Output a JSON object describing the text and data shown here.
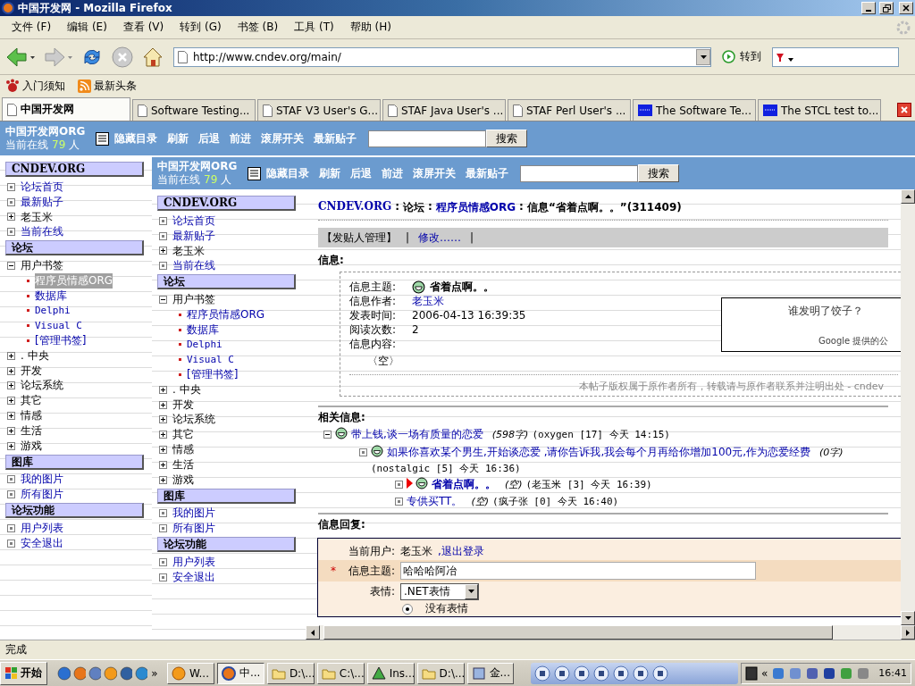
{
  "window": {
    "title": "中国开发网 - Mozilla Firefox"
  },
  "menu": [
    "文件 (F)",
    "编辑 (E)",
    "查看 (V)",
    "转到 (G)",
    "书签 (B)",
    "工具 (T)",
    "帮助 (H)"
  ],
  "navigation": {
    "url": "http://www.cndev.org/main/",
    "go_label": "转到"
  },
  "bookmarks": [
    {
      "label": "入门须知",
      "kind": "paw"
    },
    {
      "label": "最新头条",
      "kind": "feed"
    }
  ],
  "tabs": [
    {
      "label": "中国开发网",
      "selected": true,
      "kind": "page"
    },
    {
      "label": "Software Testing...",
      "selected": false,
      "kind": "page"
    },
    {
      "label": "STAF V3 User's G...",
      "selected": false,
      "kind": "page"
    },
    {
      "label": "STAF Java User's ...",
      "selected": false,
      "kind": "page"
    },
    {
      "label": "STAF Perl User's ...",
      "selected": false,
      "kind": "page"
    },
    {
      "label": "The Software Te...",
      "selected": false,
      "kind": "blue"
    },
    {
      "label": "The STCL test to...",
      "selected": false,
      "kind": "blue"
    }
  ],
  "outer_frame": {
    "header": {
      "site": "中国开发网ORG",
      "online_label": "当前在线",
      "online_count": "79",
      "online_unit": "人",
      "links": [
        "隐藏目录",
        "刷新",
        "后退",
        "前进",
        "滚屏开关",
        "最新贴子"
      ],
      "search_button": "搜索"
    },
    "sidebar": {
      "sections": [
        {
          "title": "CNDEV.ORG",
          "items": [
            {
              "label": "论坛首页",
              "kind": "link"
            },
            {
              "label": "最新贴子",
              "kind": "link"
            },
            {
              "label": "老玉米",
              "kind": "folder",
              "expanded": false
            },
            {
              "label": "当前在线",
              "kind": "link"
            }
          ]
        },
        {
          "title": "论坛",
          "items": [
            {
              "label": "用户书签",
              "kind": "folder",
              "expanded": true,
              "children": [
                {
                  "label": "程序员情感ORG",
                  "selected": true
                },
                {
                  "label": "数据库",
                  "selected": false
                },
                {
                  "label": "Delphi",
                  "selected": false
                },
                {
                  "label": "Visual C",
                  "selected": false
                },
                {
                  "label": "[管理书签]",
                  "selected": false
                }
              ]
            },
            {
              "label": ". 中央",
              "kind": "folder",
              "expanded": false
            },
            {
              "label": "开发",
              "kind": "folder",
              "expanded": false
            },
            {
              "label": "论坛系统",
              "kind": "folder",
              "expanded": false
            },
            {
              "label": "其它",
              "kind": "folder",
              "expanded": false
            },
            {
              "label": "情感",
              "kind": "folder",
              "expanded": false
            },
            {
              "label": "生活",
              "kind": "folder",
              "expanded": false
            },
            {
              "label": "游戏",
              "kind": "folder",
              "expanded": false
            }
          ]
        },
        {
          "title": "图库",
          "items": [
            {
              "label": "我的图片",
              "kind": "link"
            },
            {
              "label": "所有图片",
              "kind": "link"
            }
          ]
        },
        {
          "title": "论坛功能",
          "items": [
            {
              "label": "用户列表",
              "kind": "link"
            },
            {
              "label": "安全退出",
              "kind": "link"
            }
          ]
        }
      ]
    }
  },
  "inner_frame": {
    "header": {
      "site": "中国开发网ORG",
      "online_label": "当前在线",
      "online_count": "79",
      "online_unit": "人",
      "links": [
        "隐藏目录",
        "刷新",
        "后退",
        "前进",
        "滚屏开关",
        "最新贴子"
      ],
      "search_button": "搜索"
    },
    "sidebar": {
      "sections": [
        {
          "title": "CNDEV.ORG",
          "items": [
            {
              "label": "论坛首页",
              "kind": "link"
            },
            {
              "label": "最新贴子",
              "kind": "link"
            },
            {
              "label": "老玉米",
              "kind": "folder",
              "expanded": false
            },
            {
              "label": "当前在线",
              "kind": "link"
            }
          ]
        },
        {
          "title": "论坛",
          "items": [
            {
              "label": "用户书签",
              "kind": "folder",
              "expanded": true,
              "children": [
                {
                  "label": "程序员情感ORG",
                  "selected": false
                },
                {
                  "label": "数据库",
                  "selected": false
                },
                {
                  "label": "Delphi",
                  "selected": false
                },
                {
                  "label": "Visual C",
                  "selected": false
                },
                {
                  "label": "[管理书签]",
                  "selected": false
                }
              ]
            },
            {
              "label": ". 中央",
              "kind": "folder",
              "expanded": false
            },
            {
              "label": "开发",
              "kind": "folder",
              "expanded": false
            },
            {
              "label": "论坛系统",
              "kind": "folder",
              "expanded": false
            },
            {
              "label": "其它",
              "kind": "folder",
              "expanded": false
            },
            {
              "label": "情感",
              "kind": "folder",
              "expanded": false
            },
            {
              "label": "生活",
              "kind": "folder",
              "expanded": false
            },
            {
              "label": "游戏",
              "kind": "folder",
              "expanded": false
            }
          ]
        },
        {
          "title": "图库",
          "items": [
            {
              "label": "我的图片",
              "kind": "link"
            },
            {
              "label": "所有图片",
              "kind": "link"
            }
          ]
        },
        {
          "title": "论坛功能",
          "items": [
            {
              "label": "用户列表",
              "kind": "link"
            },
            {
              "label": "安全退出",
              "kind": "link"
            }
          ]
        }
      ]
    },
    "post": {
      "breadcrumb": {
        "separator": ":",
        "items": [
          {
            "label": "CNDEV.ORG",
            "kind": "link"
          },
          {
            "label": "论坛",
            "kind": "text"
          },
          {
            "label": "程序员情感ORG",
            "kind": "link"
          },
          {
            "label": "信息“省着点啊。。”(311409)",
            "kind": "text"
          }
        ]
      },
      "admin_bar": {
        "title": "【发贴人管理】",
        "divider": "|",
        "links": [
          "修改……"
        ]
      },
      "info_heading": "信息:",
      "info": {
        "fields": [
          {
            "label": "信息主题:",
            "value": "省着点啊。。",
            "kind": "subject"
          },
          {
            "label": "信息作者:",
            "value": "老玉米",
            "kind": "link"
          },
          {
            "label": "发表时间:",
            "value": "2006-04-13 16:39:35",
            "kind": "text"
          },
          {
            "label": "阅读次数:",
            "value": "2",
            "kind": "text"
          },
          {
            "label": "信息内容:",
            "kind": "text"
          }
        ],
        "body": "〈空〉",
        "ad": {
          "question": "谁发明了饺子？",
          "footer": "Google 提供的公"
        },
        "copyright": "本帖子版权属于原作者所有，转载请与原作者联系并注明出处 - cndev"
      },
      "related_heading": "相关信息:",
      "thread": [
        {
          "title": "带上钱,谈一场有质量的恋爱",
          "size": "(598字)",
          "meta": "(oxygen [17] 今天 14:15)",
          "kind": "folder",
          "expanded": true,
          "current": false,
          "emoticon": true,
          "children": [
            {
              "title": "如果你喜欢某个男生,开始谈恋爱 ,请你告诉我,我会每个月再给你增加100元,作为恋爱经费",
              "size": "(0字)",
              "meta": "(nostalgic [5] 今天 16:36)",
              "kind": "leaf",
              "current": false,
              "emoticon": true,
              "children": [
                {
                  "title": "省着点啊。。",
                  "size": "(空)",
                  "meta": "(老玉米 [3] 今天 16:39)",
                  "kind": "leaf",
                  "current": true,
                  "emoticon": true
                },
                {
                  "title": "专供买TT。",
                  "size": "(空)",
                  "meta": "(疯子张 [0] 今天 16:40)",
                  "kind": "leaf",
                  "current": false,
                  "emoticon": false
                }
              ]
            }
          ]
        }
      ],
      "reply_heading": "信息回复:",
      "reply": {
        "user_label": "当前用户:",
        "user": "老玉米",
        "logout": ",退出登录",
        "required_mark": "*",
        "subject_label": "信息主题:",
        "subject_value": "哈哈哈阿冶",
        "emotion_label": "表情:",
        "emotion_select": ".NET表情",
        "emotion_options": [
          {
            "label": "没有表情",
            "selected": true
          }
        ]
      }
    }
  },
  "status_bar": {
    "text": "完成"
  },
  "taskbar": {
    "start": "开始",
    "more": "»",
    "tasks": [
      {
        "label": "W...",
        "selected": false,
        "kind": "orange"
      },
      {
        "label": "中...",
        "selected": true,
        "kind": "firefox"
      },
      {
        "label": "D:\\...",
        "selected": false,
        "kind": "folder"
      },
      {
        "label": "C:\\...",
        "selected": false,
        "kind": "folder"
      },
      {
        "label": "Ins...",
        "selected": false,
        "kind": "install"
      },
      {
        "label": "D:\\...",
        "selected": false,
        "kind": "folder"
      },
      {
        "label": "金...",
        "selected": false,
        "kind": "search"
      }
    ],
    "tray_more": "«",
    "clock": "16:41"
  }
}
